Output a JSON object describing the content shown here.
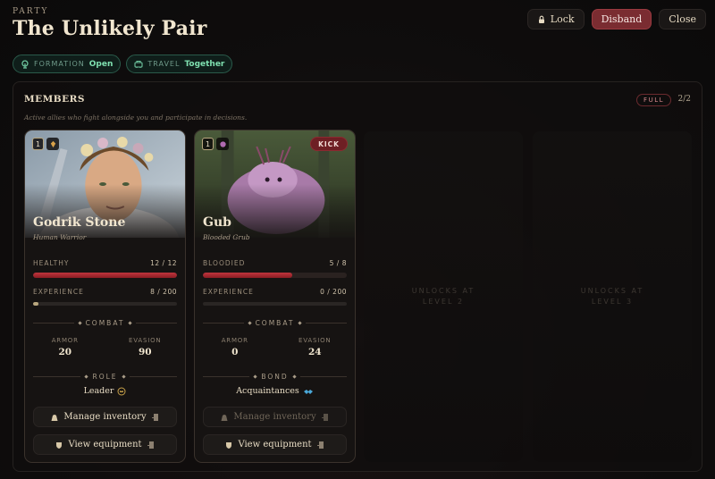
{
  "header": {
    "eyebrow": "PARTY",
    "title": "The Unlikely Pair"
  },
  "pills": [
    {
      "label": "FORMATION",
      "value": "Open",
      "icon": "formation-icon"
    },
    {
      "label": "TRAVEL",
      "value": "Together",
      "icon": "travel-icon"
    }
  ],
  "buttons": {
    "lock": "Lock",
    "disband": "Disband",
    "close": "Close"
  },
  "members": {
    "title": "MEMBERS",
    "subtitle": "Active allies who fight alongside you and participate in decisions.",
    "badge": "FULL",
    "count": "2/2"
  },
  "cards": [
    {
      "level": "1",
      "name": "Godrik Stone",
      "race": "Human Warrior",
      "health_label": "HEALTHY",
      "health_value": "12 / 12",
      "health_pct": 100,
      "xp_label": "EXPERIENCE",
      "xp_value": "8 / 200",
      "xp_pct": 4,
      "combat_label": "COMBAT",
      "armor_label": "ARMOR",
      "armor": "20",
      "evasion_label": "EVASION",
      "evasion": "90",
      "section_label": "ROLE",
      "section_value": "Leader",
      "inventory_label": "Manage inventory",
      "equipment_label": "View equipment"
    },
    {
      "level": "1",
      "kick": "KICK",
      "name": "Gub",
      "race": "Blooded Grub",
      "health_label": "BLOODIED",
      "health_value": "5 / 8",
      "health_pct": 62,
      "xp_label": "EXPERIENCE",
      "xp_value": "0 / 200",
      "xp_pct": 0,
      "combat_label": "COMBAT",
      "armor_label": "ARMOR",
      "armor": "0",
      "evasion_label": "EVASION",
      "evasion": "24",
      "section_label": "BOND",
      "section_value": "Acquaintances",
      "inventory_label": "Manage inventory",
      "equipment_label": "View equipment"
    }
  ],
  "slots": [
    {
      "line1": "UNLOCKS AT",
      "line2": "LEVEL 2"
    },
    {
      "line1": "UNLOCKS AT",
      "line2": "LEVEL 3"
    }
  ],
  "colors": {
    "accent_red": "#7a2c31",
    "health": "#c1353d",
    "teal": "#7fe0b0"
  }
}
